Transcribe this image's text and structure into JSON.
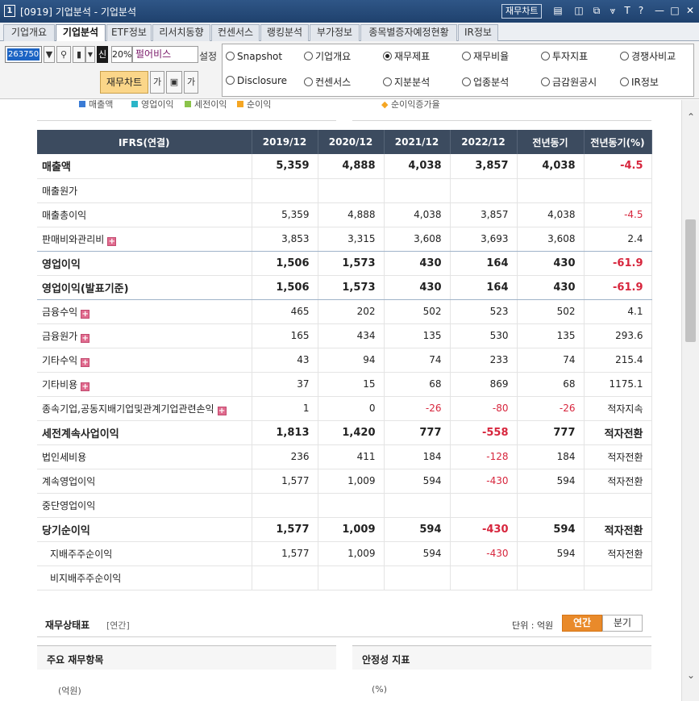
{
  "window": {
    "icon": "1",
    "title": "[0919] 기업분석 - 기업분석",
    "chart_button": "재무차트"
  },
  "tabs": [
    {
      "label": "기업개요"
    },
    {
      "label": "기업분석"
    },
    {
      "label": "ETF정보"
    },
    {
      "label": "리서치동향"
    },
    {
      "label": "컨센서스"
    },
    {
      "label": "랭킹분석"
    },
    {
      "label": "부가정보"
    },
    {
      "label": "종목별증자예정현황"
    },
    {
      "label": "IR정보"
    }
  ],
  "active_tab": "기업분석",
  "toolbar": {
    "code": "263750",
    "badge": "신",
    "percent": "20%",
    "name": "펄어비스",
    "set_label": "설정",
    "fin_chart_button": "재무차트",
    "ga_icon": "가"
  },
  "radios": [
    {
      "label": "Snapshot",
      "selected": false
    },
    {
      "label": "기업개요",
      "selected": false
    },
    {
      "label": "재무제표",
      "selected": true
    },
    {
      "label": "재무비율",
      "selected": false
    },
    {
      "label": "투자지표",
      "selected": false
    },
    {
      "label": "경쟁사비교",
      "selected": false
    },
    {
      "label": "Disclosure",
      "selected": false
    },
    {
      "label": "컨센서스",
      "selected": false
    },
    {
      "label": "지분분석",
      "selected": false
    },
    {
      "label": "업종분석",
      "selected": false
    },
    {
      "label": "금감원공시",
      "selected": false
    },
    {
      "label": "IR정보",
      "selected": false
    }
  ],
  "legend": {
    "items": [
      "매출액",
      "영업이익",
      "세전이익",
      "순이익"
    ],
    "colors": [
      "#3a7bd5",
      "#2bb5c8",
      "#8bc34a",
      "#f5a623"
    ],
    "right": "순이익증가율"
  },
  "table": {
    "headers": [
      "IFRS(연결)",
      "2019/12",
      "2020/12",
      "2021/12",
      "2022/12",
      "전년동기",
      "전년동기(%)"
    ],
    "rows": [
      {
        "label": "매출액",
        "values": [
          "5,359",
          "4,888",
          "4,038",
          "3,857",
          "4,038",
          "-4.5"
        ]
      },
      {
        "label": "매출원가",
        "values": [
          "",
          "",
          "",
          "",
          "",
          ""
        ]
      },
      {
        "label": "매출총이익",
        "values": [
          "5,359",
          "4,888",
          "4,038",
          "3,857",
          "4,038",
          "-4.5"
        ]
      },
      {
        "label": "판매비와관리비",
        "values": [
          "3,853",
          "3,315",
          "3,608",
          "3,693",
          "3,608",
          "2.4"
        ]
      },
      {
        "label": "영업이익",
        "values": [
          "1,506",
          "1,573",
          "430",
          "164",
          "430",
          "-61.9"
        ]
      },
      {
        "label": "영업이익(발표기준)",
        "values": [
          "1,506",
          "1,573",
          "430",
          "164",
          "430",
          "-61.9"
        ]
      },
      {
        "label": "금융수익",
        "values": [
          "465",
          "202",
          "502",
          "523",
          "502",
          "4.1"
        ]
      },
      {
        "label": "금융원가",
        "values": [
          "165",
          "434",
          "135",
          "530",
          "135",
          "293.6"
        ]
      },
      {
        "label": "기타수익",
        "values": [
          "43",
          "94",
          "74",
          "233",
          "74",
          "215.4"
        ]
      },
      {
        "label": "기타비용",
        "values": [
          "37",
          "15",
          "68",
          "869",
          "68",
          "1175.1"
        ]
      },
      {
        "label": "종속기업,공동지배기업및관계기업관련손익",
        "values": [
          "1",
          "0",
          "-26",
          "-80",
          "-26",
          "적자지속"
        ]
      },
      {
        "label": "세전계속사업이익",
        "values": [
          "1,813",
          "1,420",
          "777",
          "-558",
          "777",
          "적자전환"
        ]
      },
      {
        "label": "법인세비용",
        "values": [
          "236",
          "411",
          "184",
          "-128",
          "184",
          "적자전환"
        ]
      },
      {
        "label": "계속영업이익",
        "values": [
          "1,577",
          "1,009",
          "594",
          "-430",
          "594",
          "적자전환"
        ]
      },
      {
        "label": "중단영업이익",
        "values": [
          "",
          "",
          "",
          "",
          "",
          ""
        ]
      },
      {
        "label": "당기순이익",
        "values": [
          "1,577",
          "1,009",
          "594",
          "-430",
          "594",
          "적자전환"
        ]
      },
      {
        "label": "지배주주순이익",
        "values": [
          "1,577",
          "1,009",
          "594",
          "-430",
          "594",
          "적자전환"
        ]
      },
      {
        "label": "비지배주주순이익",
        "values": [
          "",
          "",
          "",
          "",
          "",
          ""
        ]
      }
    ]
  },
  "balance": {
    "title": "재무상태표",
    "period": "[연간]",
    "unit": "단위 : 억원",
    "toggle_annual": "연간",
    "toggle_quarter": "분기",
    "left_panel": "주요 재무항목",
    "right_panel": "안정성 지표",
    "left_unit": "(억원)",
    "right_unit": "(%)"
  }
}
